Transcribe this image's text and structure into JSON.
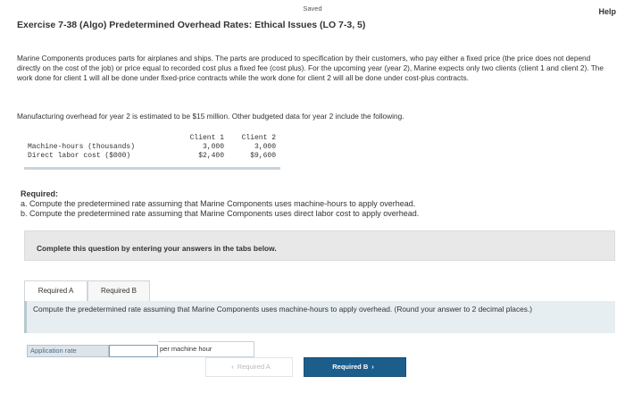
{
  "header": {
    "status": "Saved",
    "help": "Help",
    "title": "Exercise 7-38 (Algo) Predetermined Overhead Rates: Ethical Issues (LO 7-3, 5)"
  },
  "problem": {
    "text": "Marine Components produces parts for airplanes and ships. The parts are produced to specification by their customers, who pay either a fixed price (the price does not depend directly on the cost of the job) or price equal to recorded cost plus a fixed fee (cost plus). For the upcoming year (year 2), Marine expects only two clients (client 1 and client 2). The work done for client 1 will all be done under fixed-price contracts while the work done for client 2 will all be done under cost-plus contracts.",
    "overhead": "Manufacturing overhead for year 2 is estimated to be $15 million. Other budgeted data for year 2 include the following."
  },
  "table": {
    "columns": [
      "",
      "Client 1",
      "Client 2"
    ],
    "rows": [
      {
        "label": "Machine-hours (thousands)",
        "client1": "3,000",
        "client2": "3,000"
      },
      {
        "label": "Direct labor cost ($000)",
        "client1": "$2,400",
        "client2": "$9,600"
      }
    ]
  },
  "required": {
    "label": "Required:",
    "a": "a. Compute the predetermined rate assuming that Marine Components uses machine-hours to apply overhead.",
    "b": "b. Compute the predetermined rate assuming that Marine Components uses direct labor cost to apply overhead."
  },
  "complete_bar": "Complete this question by entering your answers in the tabs below.",
  "tabs": [
    {
      "label": "Required A",
      "active": true
    },
    {
      "label": "Required B",
      "active": false
    }
  ],
  "instruction": "Compute the predetermined rate assuming that Marine Components uses machine-hours to apply overhead. (Round your answer to 2 decimal places.)",
  "answer": {
    "label": "Application rate",
    "value": "",
    "unit": "per machine hour"
  },
  "nav": {
    "prev_label": "Required A",
    "next_label": "Required B"
  },
  "colors": {
    "accent": "#1b5e8c",
    "instruction_bg": "#e6eef1",
    "bar_bg": "#e8e8e8"
  }
}
